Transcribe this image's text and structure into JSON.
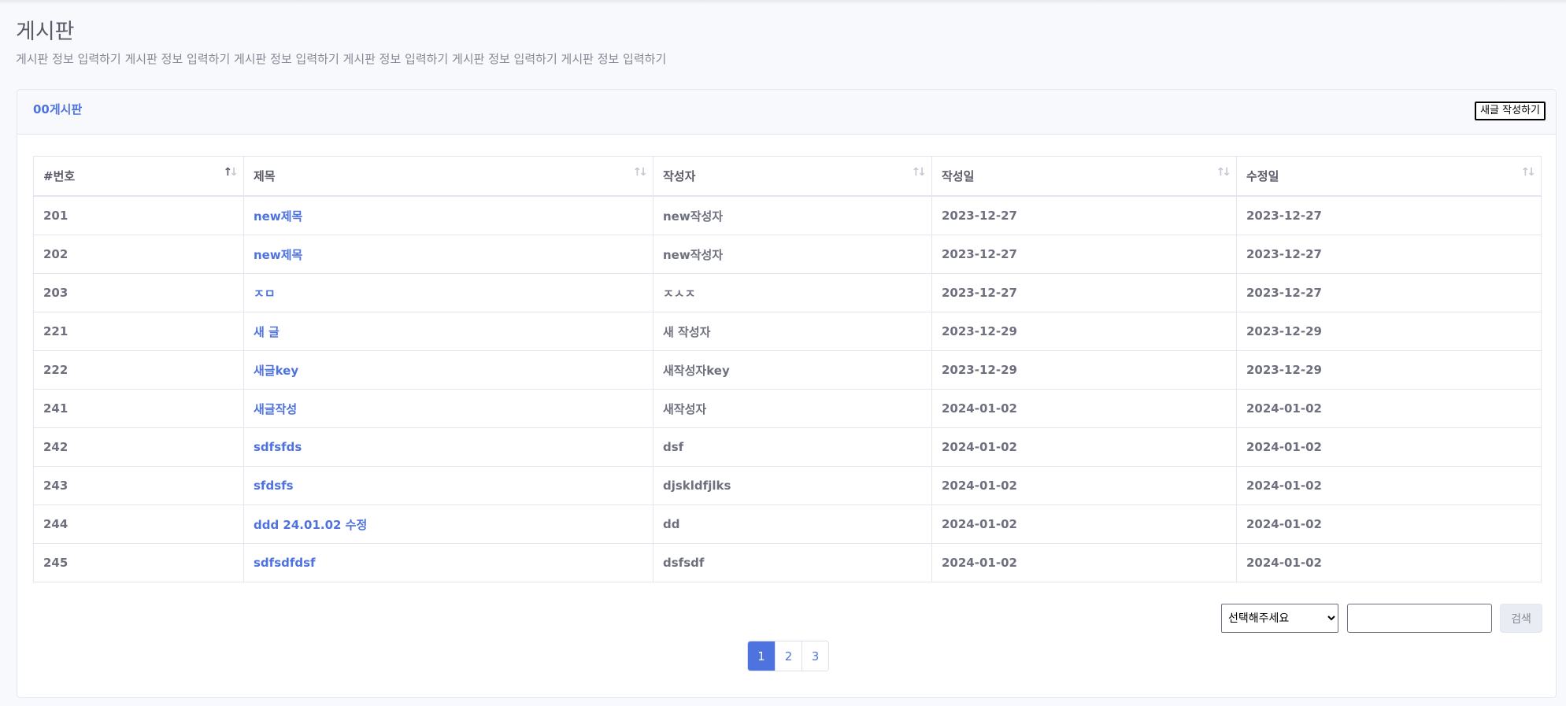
{
  "page": {
    "title": "게시판",
    "description": "게시판 정보 입력하기 게시판 정보 입력하기 게시판 정보 입력하기 게시판 정보 입력하기 게시판 정보 입력하기 게시판 정보 입력하기"
  },
  "card": {
    "title": "00게시판",
    "new_post_label": "새글 작성하기"
  },
  "table": {
    "columns": [
      "#번호",
      "제목",
      "작성자",
      "작성일",
      "수정일"
    ],
    "sorted_column": "#번호",
    "sort_direction": "ascending",
    "rows": [
      {
        "no": "201",
        "title": "new제목",
        "author": "new작성자",
        "created": "2023-12-27",
        "modified": "2023-12-27"
      },
      {
        "no": "202",
        "title": "new제목",
        "author": "new작성자",
        "created": "2023-12-27",
        "modified": "2023-12-27"
      },
      {
        "no": "203",
        "title": "ㅈㅁ",
        "author": "ㅈㅅㅈ",
        "created": "2023-12-27",
        "modified": "2023-12-27"
      },
      {
        "no": "221",
        "title": "새 글",
        "author": "새 작성자",
        "created": "2023-12-29",
        "modified": "2023-12-29"
      },
      {
        "no": "222",
        "title": "새글key",
        "author": "새작성자key",
        "created": "2023-12-29",
        "modified": "2023-12-29"
      },
      {
        "no": "241",
        "title": "새글작성",
        "author": "새작성자",
        "created": "2024-01-02",
        "modified": "2024-01-02"
      },
      {
        "no": "242",
        "title": "sdfsfds",
        "author": "dsf",
        "created": "2024-01-02",
        "modified": "2024-01-02"
      },
      {
        "no": "243",
        "title": "sfdsfs",
        "author": "djskldfjlks",
        "created": "2024-01-02",
        "modified": "2024-01-02"
      },
      {
        "no": "244",
        "title": "ddd 24.01.02 수정",
        "author": "dd",
        "created": "2024-01-02",
        "modified": "2024-01-02"
      },
      {
        "no": "245",
        "title": "sdfsdfdsf",
        "author": "dsfsdf",
        "created": "2024-01-02",
        "modified": "2024-01-02"
      }
    ]
  },
  "search": {
    "select_value": "선택해주세요",
    "input_value": "",
    "button_label": "검색"
  },
  "pagination": {
    "pages": [
      "1",
      "2",
      "3"
    ],
    "current": "1"
  },
  "colors": {
    "accent": "#4e73df",
    "text": "#5a5c69",
    "border": "#e3e6f0",
    "background": "#f8f9fc"
  },
  "icons": {
    "sort": "sort-arrows-icon",
    "select_caret": "chevron-down-icon"
  }
}
